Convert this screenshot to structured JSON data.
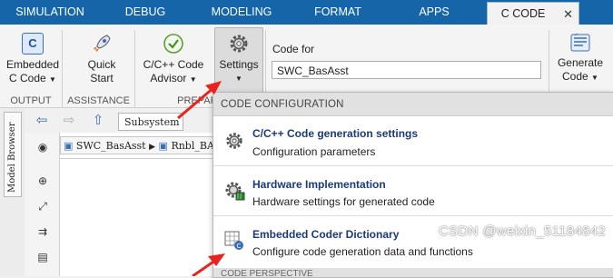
{
  "tabs": [
    "SIMULATION",
    "DEBUG",
    "MODELING",
    "FORMAT",
    "APPS",
    "C CODE"
  ],
  "close_glyph": "✕",
  "ribbon": {
    "embedded_c_code": {
      "line1": "Embedded",
      "line2": "C Code",
      "icon": "c-code-icon"
    },
    "quick_start": {
      "line1": "Quick",
      "line2": "Start",
      "icon": "rocket-icon"
    },
    "code_advisor": {
      "line1": "C/C++ Code",
      "line2": "Advisor",
      "icon": "check-icon"
    },
    "settings": {
      "line1": "Settings",
      "icon": "gear-icon"
    },
    "code_for_label": "Code for",
    "code_for_value": "SWC_BasAsst",
    "generate_code": {
      "line1": "Generate",
      "line2": "Code",
      "icon": "generate-code-icon"
    },
    "group_labels": {
      "output": "OUTPUT",
      "assistance": "ASSISTANCE",
      "prepare": "PREPARE"
    }
  },
  "model_browser_label": "Model Browser",
  "subsystem_tab": "Subsystem",
  "breadcrumb": {
    "root": "SWC_BasAsst",
    "child": "Rnbl_BA_"
  },
  "dropdown": {
    "header": "CODE CONFIGURATION",
    "items": [
      {
        "title": "C/C++ Code generation settings",
        "desc": "Configuration parameters",
        "icon": "gear-icon"
      },
      {
        "title": "Hardware Implementation",
        "desc": "Hardware settings for generated code",
        "icon": "hardware-gear-icon"
      },
      {
        "title": "Embedded Coder Dictionary",
        "desc": "Configure code generation data and functions",
        "icon": "dictionary-icon"
      }
    ],
    "footer": "CODE PERSPECTIVE"
  },
  "watermark": "CSDN @weixin_51184842",
  "colors": {
    "tabbar": "#1565a8",
    "accent_title": "#1b3a7a",
    "arrow": "#e8231f"
  }
}
